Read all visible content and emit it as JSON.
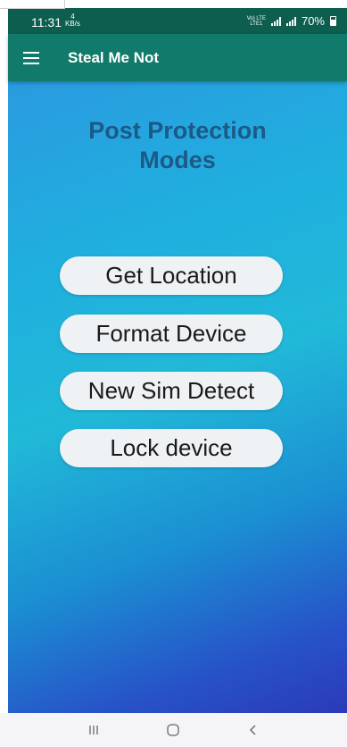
{
  "status_bar": {
    "time": "11:31",
    "data_rate_value": "4",
    "data_rate_unit": "KB/s",
    "network_label_top": "Vo) LTE",
    "network_label_bottom": "LTE1",
    "battery": "70%"
  },
  "app_bar": {
    "title": "Steal Me Not",
    "menu_icon": "hamburger-menu-icon"
  },
  "main": {
    "heading_line1": "Post Protection",
    "heading_line2": "Modes",
    "buttons": [
      {
        "label": "Get Location"
      },
      {
        "label": "Format Device"
      },
      {
        "label": "New Sim Detect"
      },
      {
        "label": "Lock device"
      }
    ]
  },
  "nav_bar": {
    "recents_icon": "recent-apps-icon",
    "home_icon": "home-icon",
    "back_icon": "back-icon"
  },
  "colors": {
    "status_bar": "#0d5e4f",
    "app_bar": "#127a6a",
    "heading": "#1c5a86",
    "button_bg": "#eef2f4"
  }
}
